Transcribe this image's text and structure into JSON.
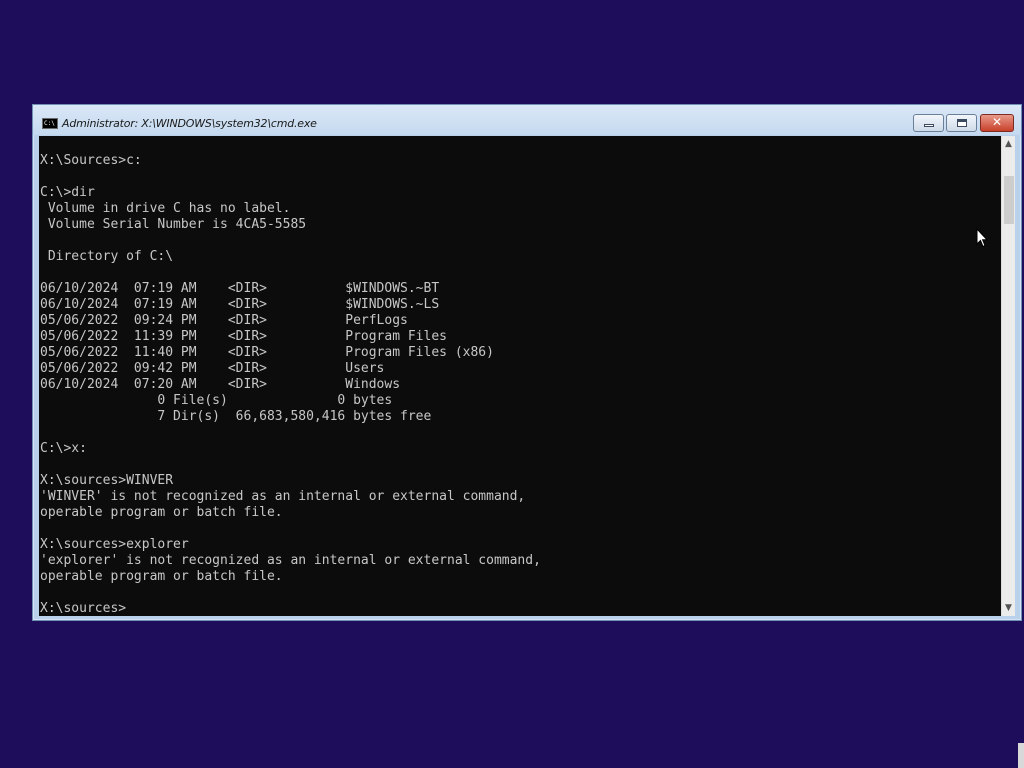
{
  "window": {
    "title": "Administrator: X:\\WINDOWS\\system32\\cmd.exe",
    "icon": "cmd-icon",
    "icon_text": "C:\\",
    "buttons": {
      "minimize": "minimize-icon",
      "maximize": "maximize-icon",
      "close_glyph": "✕"
    }
  },
  "console": {
    "lines": [
      "X:\\Sources>c:",
      "",
      "C:\\>dir",
      " Volume in drive C has no label.",
      " Volume Serial Number is 4CA5-5585",
      "",
      " Directory of C:\\",
      "",
      "06/10/2024  07:19 AM    <DIR>          $WINDOWS.~BT",
      "06/10/2024  07:19 AM    <DIR>          $WINDOWS.~LS",
      "05/06/2022  09:24 PM    <DIR>          PerfLogs",
      "05/06/2022  11:39 PM    <DIR>          Program Files",
      "05/06/2022  11:40 PM    <DIR>          Program Files (x86)",
      "05/06/2022  09:42 PM    <DIR>          Users",
      "06/10/2024  07:20 AM    <DIR>          Windows",
      "               0 File(s)              0 bytes",
      "               7 Dir(s)  66,683,580,416 bytes free",
      "",
      "C:\\>x:",
      "",
      "X:\\sources>WINVER",
      "'WINVER' is not recognized as an internal or external command,",
      "operable program or batch file.",
      "",
      "X:\\sources>explorer",
      "'explorer' is not recognized as an internal or external command,",
      "operable program or batch file.",
      "",
      "X:\\sources>"
    ]
  },
  "scrollbar": {
    "up_arrow": "▲",
    "down_arrow": "▼"
  },
  "colors": {
    "desktop": "#1d0d5a",
    "console_bg": "#0c0c0c",
    "console_text": "#c7c7c7",
    "close_button": "#c8402b"
  }
}
